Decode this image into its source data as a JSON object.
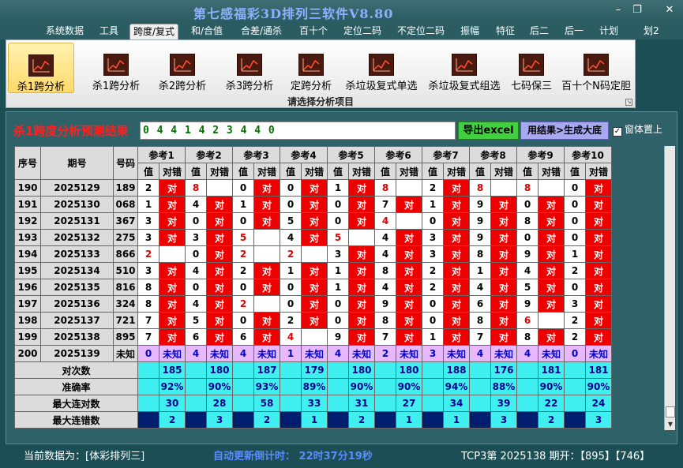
{
  "app": {
    "title": "第七感福彩3D排列三软件V8.80"
  },
  "window_controls": {
    "minimize": "–",
    "restore": "❐",
    "close": "✕"
  },
  "menu": [
    "系统数据",
    "工具",
    "跨度/复式",
    "和/合值",
    "合差/通杀",
    "百十个",
    "定位二码",
    "不定位二码",
    "振幅",
    "特征",
    "后二",
    "后一",
    "计划",
    "划2"
  ],
  "menu_active": 2,
  "ribbon": {
    "buttons": [
      "杀1跨分析",
      "杀1跨分析",
      "杀2跨分析",
      "杀3跨分析",
      "定跨分析",
      "杀垃圾复式单选",
      "杀垃圾复式组选",
      "七码保三",
      "百十个N码定胆"
    ],
    "active_index": 0,
    "icon": "line-chart-icon",
    "caption": "请选择分析项目"
  },
  "result": {
    "title": "杀1跨度分析预测结果",
    "value": "0 4 4 1 4 2 3 4 4 0",
    "export_label": "导出excel",
    "generate_label": "用结果>生成大底",
    "topmost_label": "窗体置上",
    "topmost_checked": "✓"
  },
  "table": {
    "headers": {
      "seq": "序号",
      "period": "期号",
      "number": "号码",
      "value": "值",
      "hit": "对错"
    },
    "refs": [
      "参考1",
      "参考2",
      "参考3",
      "参考4",
      "参考5",
      "参考6",
      "参考7",
      "参考8",
      "参考9",
      "参考10"
    ],
    "hit_text": "对",
    "rows": [
      {
        "seq": "190",
        "period": "2025129",
        "number": "189",
        "vals": [
          "2",
          "8",
          "0",
          "0",
          "1",
          "8",
          "2",
          "8",
          "8",
          "0"
        ],
        "hits": [
          1,
          0,
          1,
          1,
          1,
          0,
          1,
          0,
          0,
          1
        ],
        "hl": [
          0,
          1,
          0,
          0,
          0,
          1,
          0,
          1,
          1,
          0
        ]
      },
      {
        "seq": "191",
        "period": "2025130",
        "number": "068",
        "vals": [
          "1",
          "4",
          "1",
          "0",
          "0",
          "7",
          "1",
          "9",
          "0",
          "0"
        ],
        "hits": [
          1,
          1,
          1,
          1,
          1,
          1,
          1,
          1,
          1,
          1
        ],
        "hl": [
          0,
          0,
          0,
          0,
          0,
          0,
          0,
          0,
          0,
          0
        ]
      },
      {
        "seq": "192",
        "period": "2025131",
        "number": "367",
        "vals": [
          "3",
          "0",
          "0",
          "5",
          "0",
          "4",
          "0",
          "9",
          "8",
          "0"
        ],
        "hits": [
          1,
          1,
          1,
          1,
          1,
          0,
          1,
          1,
          1,
          1
        ],
        "hl": [
          0,
          0,
          0,
          0,
          0,
          1,
          0,
          0,
          0,
          0
        ]
      },
      {
        "seq": "193",
        "period": "2025132",
        "number": "275",
        "vals": [
          "3",
          "3",
          "5",
          "4",
          "5",
          "4",
          "3",
          "9",
          "0",
          "0"
        ],
        "hits": [
          1,
          1,
          0,
          1,
          0,
          1,
          1,
          1,
          1,
          1
        ],
        "hl": [
          0,
          0,
          1,
          0,
          1,
          0,
          0,
          0,
          0,
          0
        ]
      },
      {
        "seq": "194",
        "period": "2025133",
        "number": "866",
        "vals": [
          "2",
          "0",
          "2",
          "2",
          "3",
          "4",
          "3",
          "8",
          "9",
          "1"
        ],
        "hits": [
          0,
          1,
          0,
          0,
          1,
          1,
          1,
          1,
          1,
          1
        ],
        "hl": [
          1,
          0,
          1,
          1,
          0,
          0,
          0,
          0,
          0,
          0
        ]
      },
      {
        "seq": "195",
        "period": "2025134",
        "number": "510",
        "vals": [
          "3",
          "4",
          "2",
          "1",
          "1",
          "8",
          "2",
          "1",
          "4",
          "2"
        ],
        "hits": [
          1,
          1,
          1,
          1,
          1,
          1,
          1,
          1,
          1,
          1
        ],
        "hl": [
          0,
          0,
          0,
          0,
          0,
          0,
          0,
          0,
          0,
          0
        ]
      },
      {
        "seq": "196",
        "period": "2025135",
        "number": "816",
        "vals": [
          "8",
          "0",
          "0",
          "0",
          "1",
          "4",
          "2",
          "4",
          "5",
          "0"
        ],
        "hits": [
          1,
          1,
          1,
          1,
          1,
          1,
          1,
          1,
          1,
          1
        ],
        "hl": [
          0,
          0,
          0,
          0,
          0,
          0,
          0,
          0,
          0,
          0
        ]
      },
      {
        "seq": "197",
        "period": "2025136",
        "number": "324",
        "vals": [
          "8",
          "4",
          "2",
          "0",
          "0",
          "9",
          "0",
          "6",
          "9",
          "3"
        ],
        "hits": [
          1,
          1,
          0,
          1,
          1,
          1,
          1,
          1,
          1,
          1
        ],
        "hl": [
          0,
          0,
          1,
          0,
          0,
          0,
          0,
          0,
          0,
          0
        ]
      },
      {
        "seq": "198",
        "period": "2025137",
        "number": "721",
        "vals": [
          "7",
          "5",
          "0",
          "2",
          "0",
          "8",
          "0",
          "8",
          "6",
          "2"
        ],
        "hits": [
          1,
          1,
          1,
          1,
          1,
          1,
          1,
          1,
          0,
          1
        ],
        "hl": [
          0,
          0,
          0,
          0,
          0,
          0,
          0,
          0,
          1,
          0
        ]
      },
      {
        "seq": "199",
        "period": "2025138",
        "number": "895",
        "vals": [
          "7",
          "6",
          "6",
          "4",
          "9",
          "7",
          "1",
          "7",
          "8",
          "2"
        ],
        "hits": [
          1,
          1,
          1,
          0,
          1,
          1,
          1,
          1,
          1,
          1
        ],
        "hl": [
          0,
          0,
          0,
          1,
          0,
          0,
          0,
          0,
          0,
          0
        ]
      }
    ],
    "pred_row": {
      "seq": "200",
      "period": "2025139",
      "number": "未知",
      "vals": [
        "0",
        "4",
        "4",
        "1",
        "4",
        "2",
        "3",
        "4",
        "4",
        "0"
      ],
      "hit": "未知"
    },
    "stats": [
      {
        "label": "对次数",
        "values": [
          "185",
          "180",
          "187",
          "179",
          "180",
          "180",
          "188",
          "176",
          "181",
          "181"
        ]
      },
      {
        "label": "准确率",
        "values": [
          "92%",
          "90%",
          "93%",
          "89%",
          "90%",
          "90%",
          "94%",
          "88%",
          "90%",
          "90%"
        ]
      },
      {
        "label": "最大连对数",
        "values": [
          "30",
          "28",
          "58",
          "33",
          "31",
          "27",
          "34",
          "39",
          "22",
          "24"
        ]
      },
      {
        "label": "最大连错数",
        "values": [
          "2",
          "3",
          "2",
          "1",
          "2",
          "1",
          "1",
          "3",
          "2",
          "3"
        ]
      }
    ]
  },
  "status": {
    "current_data": "当前数据为：[体彩排列三]",
    "countdown": "自动更新倒计时： 22时37分19秒",
    "draw": "TCP3第 2025138 期开：【895】【746】"
  },
  "colors": {
    "hit": "#ee0000",
    "stat": "#40f0f0",
    "pred": "#e8b8ff",
    "title": "#ff2020"
  }
}
